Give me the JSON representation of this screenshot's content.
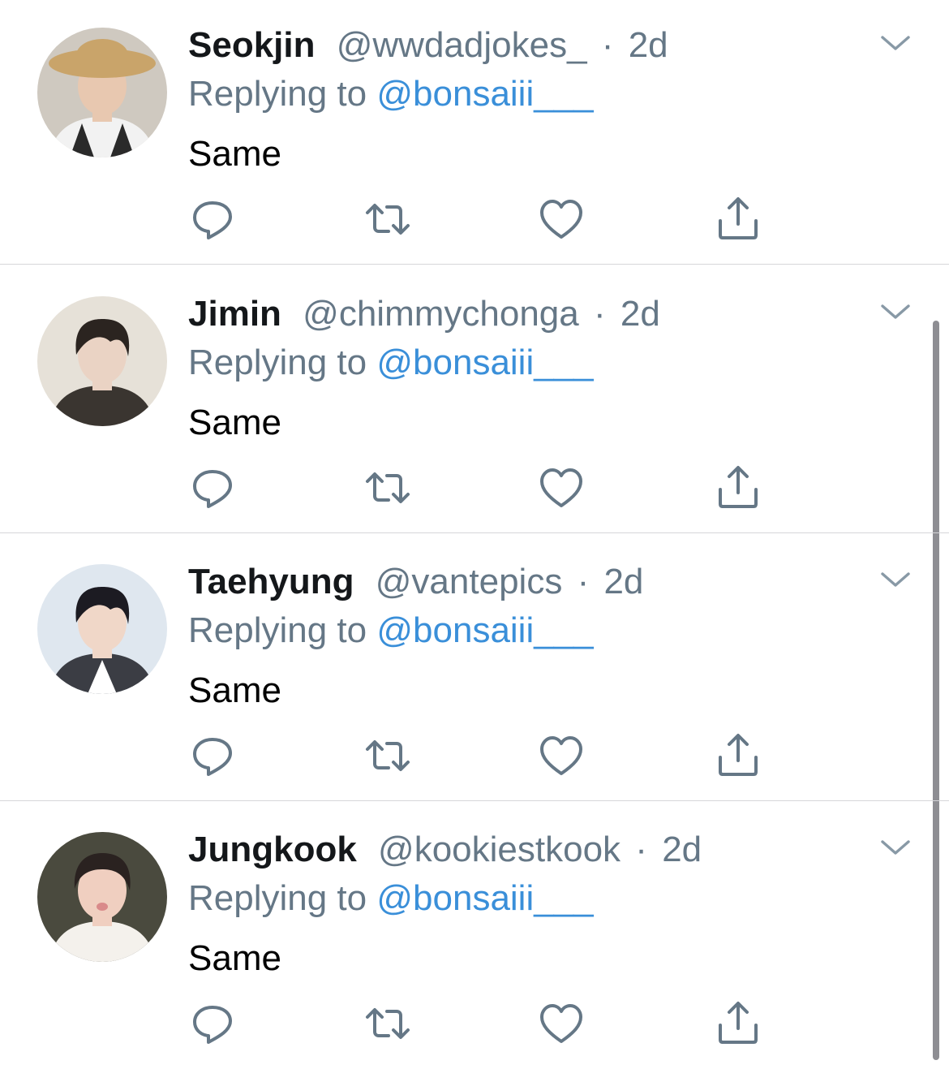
{
  "reply_prefix": "Replying to ",
  "separator": "·",
  "tweets": [
    {
      "name": "Seokjin",
      "handle": "@wwdadjokes_",
      "time": "2d",
      "replying_to": "@bonsaiii___",
      "text": "Same",
      "avatar_colors": {
        "bg": "#cfc9c0",
        "skin": "#e8c8b0",
        "hat": "#c9a46a",
        "shirt": "#f2f2f2",
        "accent": "#2a2a2a"
      }
    },
    {
      "name": "Jimin",
      "handle": "@chimmychonga",
      "time": "2d",
      "replying_to": "@bonsaiii___",
      "text": "Same",
      "avatar_colors": {
        "bg": "#e6e1d8",
        "skin": "#ead3c4",
        "hair": "#2b2420",
        "shirt": "#3a3530",
        "accent": "#1a1a1a"
      }
    },
    {
      "name": "Taehyung",
      "handle": "@vantepics",
      "time": "2d",
      "replying_to": "@bonsaiii___",
      "text": "Same",
      "avatar_colors": {
        "bg": "#dfe7ef",
        "skin": "#f0d7c8",
        "hair": "#1c1b22",
        "shirt": "#3b3d44",
        "accent": "#ffffff"
      }
    },
    {
      "name": "Jungkook",
      "handle": "@kookiestkook",
      "time": "2d",
      "replying_to": "@bonsaiii___",
      "text": "Same",
      "avatar_colors": {
        "bg": "#4a4a3e",
        "skin": "#f0cfc0",
        "hair": "#2a2220",
        "shirt": "#f4f1ec",
        "accent": "#d98a8a"
      }
    }
  ],
  "icons": {
    "reply": "speech-bubble-icon",
    "retweet": "retweet-arrows-icon",
    "like": "heart-icon",
    "share": "share-upload-icon",
    "menu": "chevron-down-icon"
  },
  "colors": {
    "name": "#14171a",
    "meta": "#657786",
    "link": "#3a8fd9",
    "icon": "#657786",
    "divider": "#d6d6d9"
  }
}
